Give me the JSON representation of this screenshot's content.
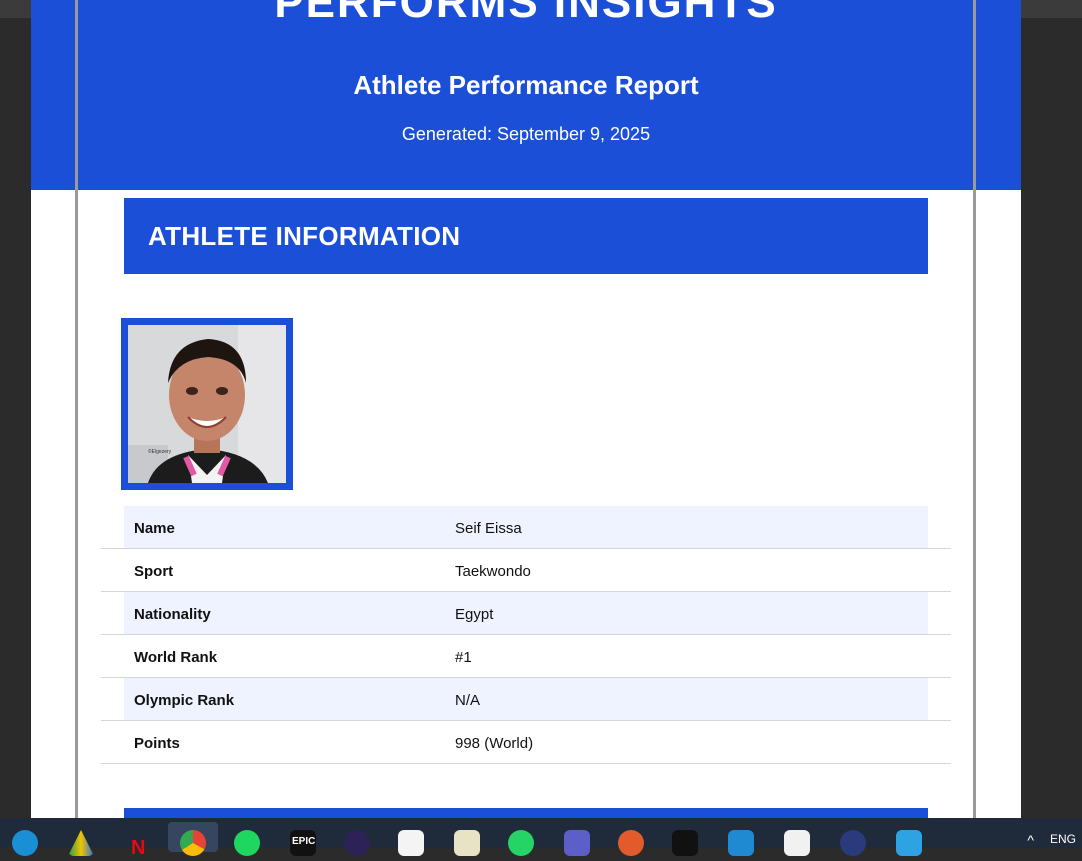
{
  "header": {
    "brand": "PERFORMS INSIGHTS",
    "report_title": "Athlete Performance Report",
    "generated": "Generated: September 9, 2025"
  },
  "section": {
    "title": "ATHLETE INFORMATION"
  },
  "photo": {
    "caption": "©Elgezery"
  },
  "athlete": {
    "rows": [
      {
        "label": "Name",
        "value": "Seif Eissa"
      },
      {
        "label": "Sport",
        "value": "Taekwondo"
      },
      {
        "label": "Nationality",
        "value": "Egypt"
      },
      {
        "label": "World Rank",
        "value": "#1"
      },
      {
        "label": "Olympic Rank",
        "value": "N/A"
      },
      {
        "label": "Points",
        "value": "998 (World)"
      }
    ]
  },
  "taskbar": {
    "icons": [
      "edge-icon",
      "google-drive-icon",
      "netflix-icon",
      "chrome-icon",
      "spotify-icon",
      "epic-games-icon",
      "eclipse-icon",
      "app-icon",
      "notes-icon",
      "whatsapp-icon",
      "teams-icon",
      "owl-icon",
      "nvidia-icon",
      "vscode-icon",
      "document-icon",
      "network-icon",
      "notepad-icon"
    ],
    "language": "ENG"
  },
  "colors": {
    "accent": "#1c4fd8",
    "row_alt": "#eef3ff"
  }
}
